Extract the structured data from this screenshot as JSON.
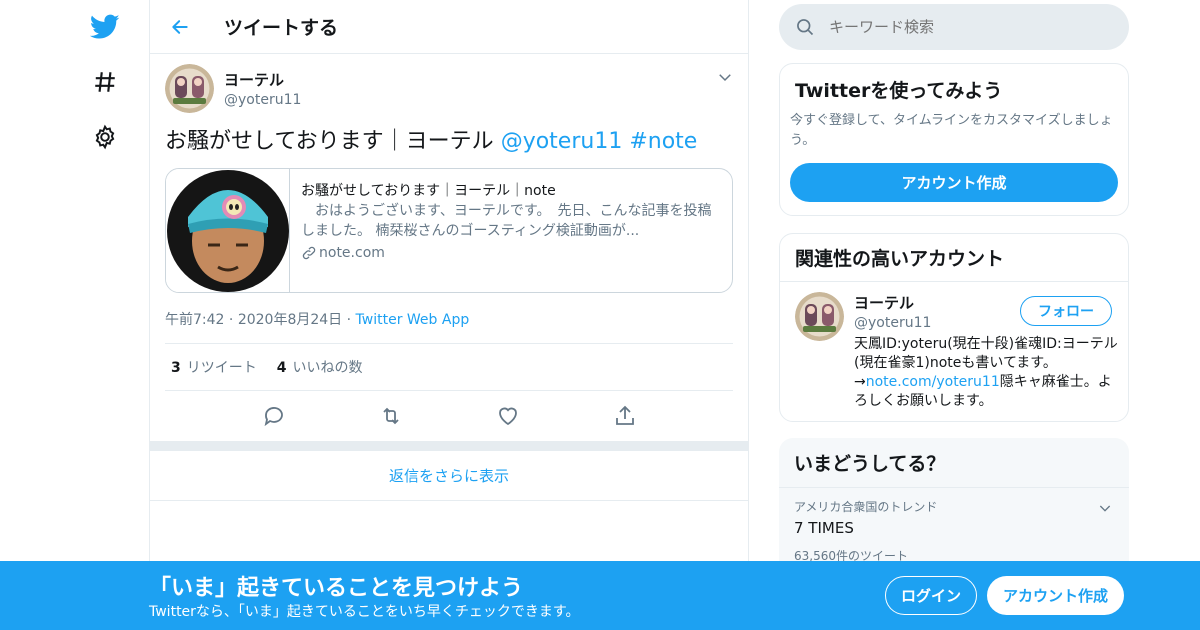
{
  "nav": {
    "items": [
      "twitter-logo",
      "explore-hashtag",
      "settings"
    ]
  },
  "header": {
    "title": "ツイートする"
  },
  "tweet": {
    "name": "ヨーテル",
    "handle": "@yoteru11",
    "text": "お騒がせしております｜ヨーテル",
    "mention": "@yoteru11",
    "hashtag": "#note",
    "card": {
      "title": "お騒がせしております｜ヨーテル｜note",
      "description": "　おはようございます、ヨーテルです。　先日、こんな記事を投稿しました。 楠栞桜さんのゴースティング検証動画が...",
      "domain": "note.com"
    },
    "time": "午前7:42",
    "date": "2020年8月24日",
    "source": "Twitter Web App",
    "retweets": "3",
    "retweets_label": "リツイート",
    "likes": "4",
    "likes_label": "いいねの数"
  },
  "more_replies": "返信をさらに表示",
  "search": {
    "placeholder": "キーワード検索"
  },
  "signup_box": {
    "title": "Twitterを使ってみよう",
    "text": "今すぐ登録して、タイムラインをカスタマイズしましょう。",
    "button": "アカウント作成"
  },
  "related": {
    "title": "関連性の高いアカウント",
    "name": "ヨーテル",
    "handle": "@yoteru11",
    "follow": "フォロー",
    "bio_1": "天鳳ID:yoteru(現在十段)雀魂ID:ヨーテル(現在雀豪1)noteも書いてます。→",
    "bio_link": "note.com/yoteru11",
    "bio_2": "隠キャ麻雀士。よろしくお願いします。"
  },
  "trends": {
    "title": "いまどうしてる？",
    "context": "アメリカ合衆国のトレンド",
    "name": "7 TIMES",
    "count": "63,560件のツイート"
  },
  "banner": {
    "title": "「いま」起きていることを見つけよう",
    "subtitle": "Twitterなら、「いま」起きていることをいち早くチェックできます。",
    "login": "ログイン",
    "signup": "アカウント作成"
  },
  "colors": {
    "accent": "#1da1f2",
    "text": "#14171a",
    "muted": "#657786",
    "border": "#e6ecf0"
  }
}
